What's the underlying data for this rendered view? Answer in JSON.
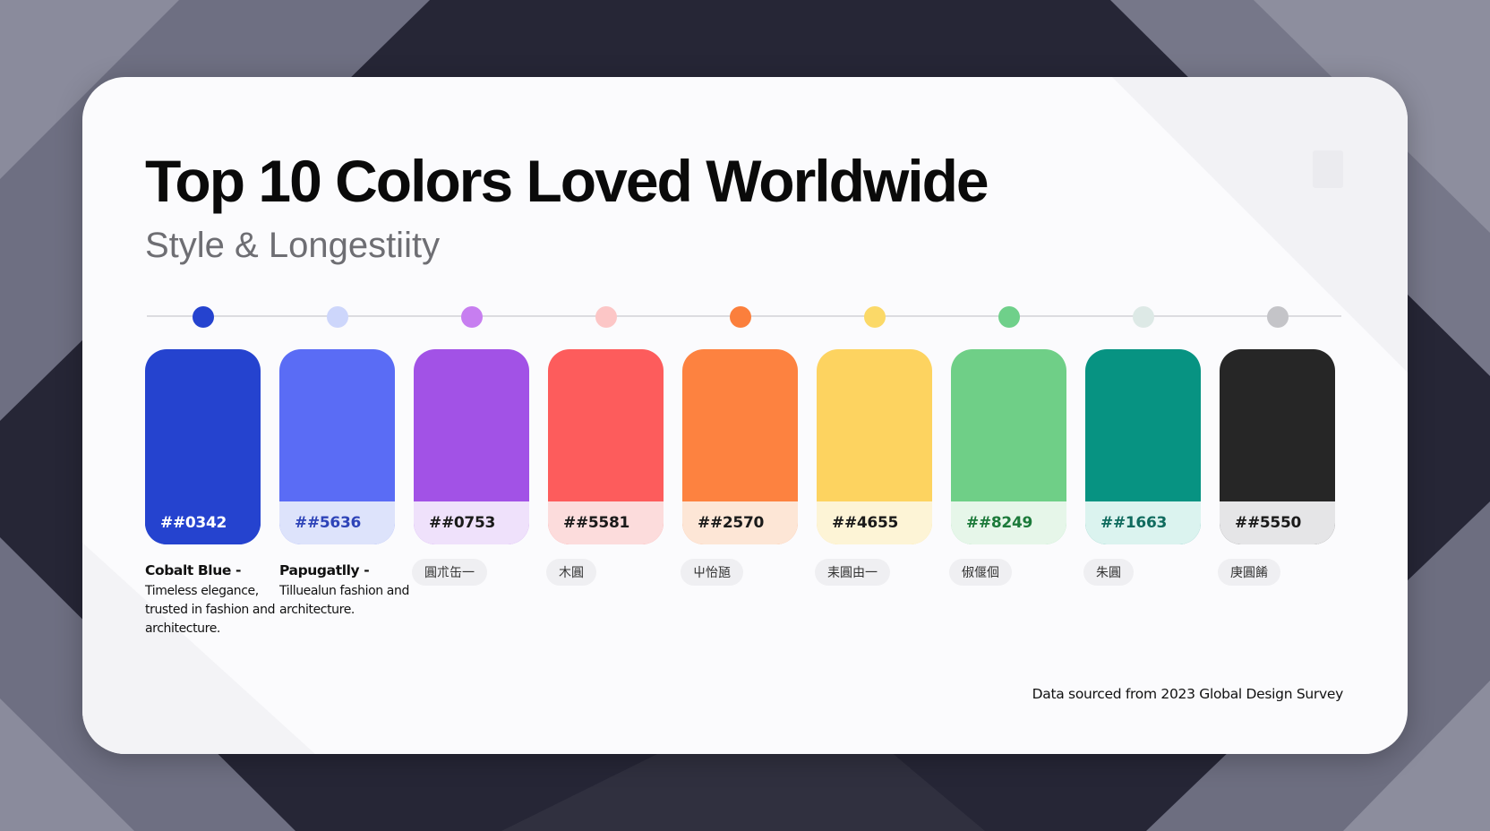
{
  "title": "Top 10 Colors Loved Worldwide",
  "subtitle": "Style & Longestiity",
  "footnote": "Data sourced from 2023 Global Design Survey",
  "colors": [
    {
      "hex_label": "##0342",
      "swatch_color": "#2543cf",
      "hex_bg": "#2543cf",
      "hex_text_color": "#ffffff",
      "dot_color": "#2543cf",
      "name": "Cobalt Blue -",
      "description": "Timeless elegance, trusted in fashion and architecture."
    },
    {
      "hex_label": "##5636",
      "swatch_color": "#5a6cf5",
      "hex_bg": "#dde3fb",
      "hex_text_color": "#2e44b8",
      "dot_color": "#cdd6fb",
      "name": "Papugatlly -",
      "description": "Tilluealun fashion and architecture."
    },
    {
      "hex_label": "##0753",
      "swatch_color": "#a252e6",
      "hex_bg": "#efe1fb",
      "hex_text_color": "#1a1a1a",
      "dot_color": "#c77ef0",
      "pill": "圓朮缶一"
    },
    {
      "hex_label": "##5581",
      "swatch_color": "#fd5c5c",
      "hex_bg": "#fcdcdc",
      "hex_text_color": "#1a1a1a",
      "dot_color": "#fcc6c6",
      "pill": "木圓"
    },
    {
      "hex_label": "##2570",
      "swatch_color": "#fd8240",
      "hex_bg": "#fde6d6",
      "hex_text_color": "#1a1a1a",
      "dot_color": "#fb7f3c",
      "pill": "屮怡瓸"
    },
    {
      "hex_label": "##4655",
      "swatch_color": "#fdd360",
      "hex_bg": "#fdf4d6",
      "hex_text_color": "#1a1a1a",
      "dot_color": "#fbd968",
      "pill": "耒圓由一"
    },
    {
      "hex_label": "##8249",
      "swatch_color": "#6fcf87",
      "hex_bg": "#e6f6e9",
      "hex_text_color": "#1c7a3a",
      "dot_color": "#6fd08a",
      "pill": "俶偃佪"
    },
    {
      "hex_label": "##1663",
      "swatch_color": "#079382",
      "hex_bg": "#dbf3ef",
      "hex_text_color": "#0f6b5e",
      "dot_color": "#dde9e6",
      "pill": "朱圓"
    },
    {
      "hex_label": "##5550",
      "swatch_color": "#262626",
      "hex_bg": "#e5e5e7",
      "hex_text_color": "#1a1a1a",
      "dot_color": "#c4c4c8",
      "pill": "庚圓餚"
    }
  ]
}
